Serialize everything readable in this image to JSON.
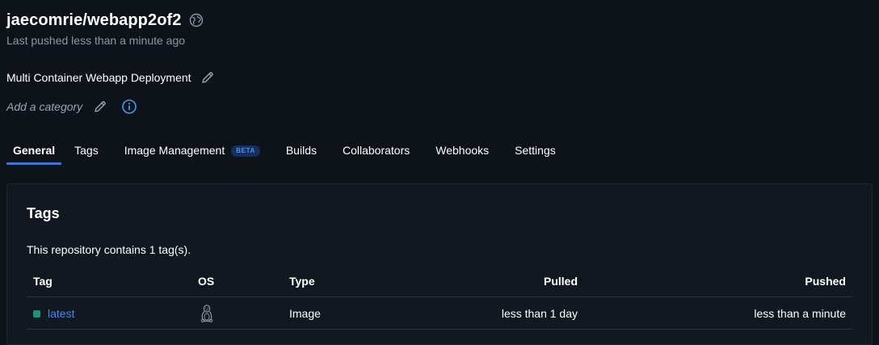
{
  "repo": {
    "title": "jaecomrie/webapp2of2",
    "last_pushed": "Last pushed less than a minute ago",
    "description": "Multi Container Webapp Deployment",
    "category_placeholder": "Add a category"
  },
  "tabs": [
    {
      "label": "General",
      "active": true
    },
    {
      "label": "Tags"
    },
    {
      "label": "Image Management",
      "badge": "BETA"
    },
    {
      "label": "Builds"
    },
    {
      "label": "Collaborators"
    },
    {
      "label": "Webhooks"
    },
    {
      "label": "Settings"
    }
  ],
  "tags_panel": {
    "title": "Tags",
    "count_text": "This repository contains 1 tag(s).",
    "columns": [
      "Tag",
      "OS",
      "Type",
      "Pulled",
      "Pushed"
    ],
    "rows": [
      {
        "tag": "latest",
        "os_icon": "linux-icon",
        "type": "Image",
        "pulled": "less than 1 day",
        "pushed": "less than a minute"
      }
    ]
  },
  "colors": {
    "background": "#0e1319",
    "accent": "#2b7ce9",
    "link": "#3d8df5",
    "status_ok": "#1d9478"
  }
}
